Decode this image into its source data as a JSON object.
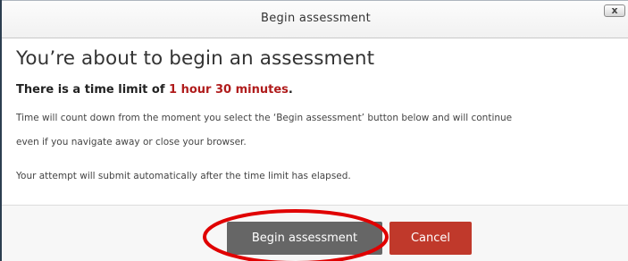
{
  "dialog": {
    "title": "Begin assessment",
    "close_label": "x"
  },
  "content": {
    "heading": "You’re about to begin an assessment",
    "time_limit_prefix": "There is a time limit of ",
    "time_limit_value": "1 hour 30 minutes",
    "time_limit_suffix": ".",
    "paragraph1": "Time will count down from the moment you select the ‘Begin assessment’ button below and will continue",
    "paragraph2": "even if you navigate away or close your browser.",
    "paragraph3": "Your attempt will submit automatically after the time limit has elapsed."
  },
  "footer": {
    "begin_label": "Begin assessment",
    "cancel_label": "Cancel"
  },
  "colors": {
    "time_limit": "#b01c1c",
    "begin_button": "#666666",
    "cancel_button": "#c0392b",
    "highlight_ring": "#e00000"
  }
}
